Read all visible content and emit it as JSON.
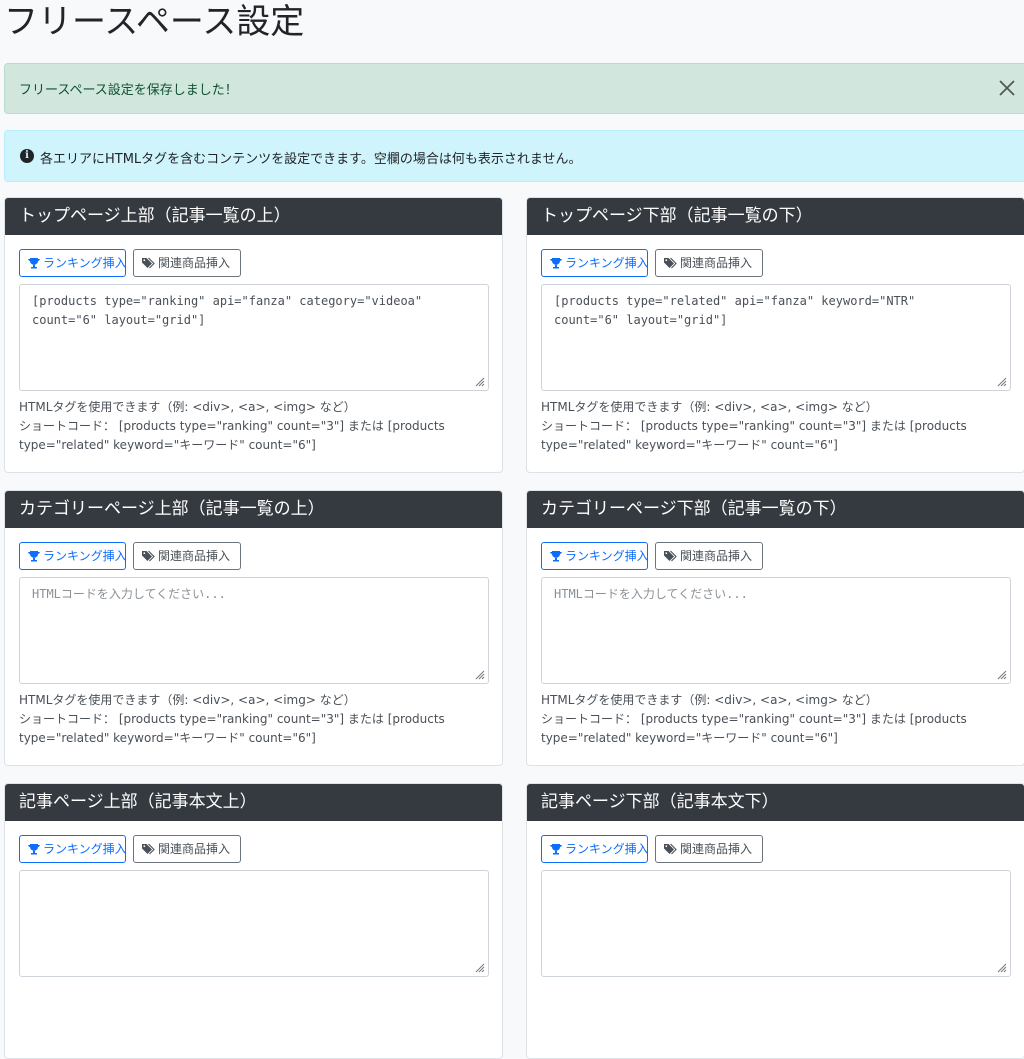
{
  "page": {
    "title": "フリースペース設定"
  },
  "alerts": {
    "success": "フリースペース設定を保存しました！",
    "info": "各エリアにHTMLタグを含むコンテンツを設定できます。空欄の場合は何も表示されません。"
  },
  "buttons": {
    "ranking": "ランキング挿入",
    "related": "関連商品挿入"
  },
  "help": {
    "line1": "HTMLタグを使用できます（例: <div>, <a>, <img> など）",
    "line2": "ショートコード： [products type=\"ranking\" count=\"3\"] または [products type=\"related\" keyword=\"キーワード\" count=\"6\"]"
  },
  "placeholder": "HTMLコードを入力してください...",
  "cards": [
    {
      "title": "トップページ上部（記事一覧の上）",
      "value": "[products type=\"ranking\" api=\"fanza\" category=\"videoa\"\ncount=\"6\" layout=\"grid\"]"
    },
    {
      "title": "トップページ下部（記事一覧の下）",
      "value": "[products type=\"related\" api=\"fanza\" keyword=\"NTR\"\ncount=\"6\" layout=\"grid\"]"
    },
    {
      "title": "カテゴリーページ上部（記事一覧の上）",
      "value": ""
    },
    {
      "title": "カテゴリーページ下部（記事一覧の下）",
      "value": ""
    },
    {
      "title": "記事ページ上部（記事本文上）",
      "value": ""
    },
    {
      "title": "記事ページ下部（記事本文下）",
      "value": ""
    }
  ],
  "colors": {
    "header": "#343a40",
    "primary": "#0d6efd",
    "success_bg": "#d1e7dd",
    "info_bg": "#cff4fc"
  }
}
